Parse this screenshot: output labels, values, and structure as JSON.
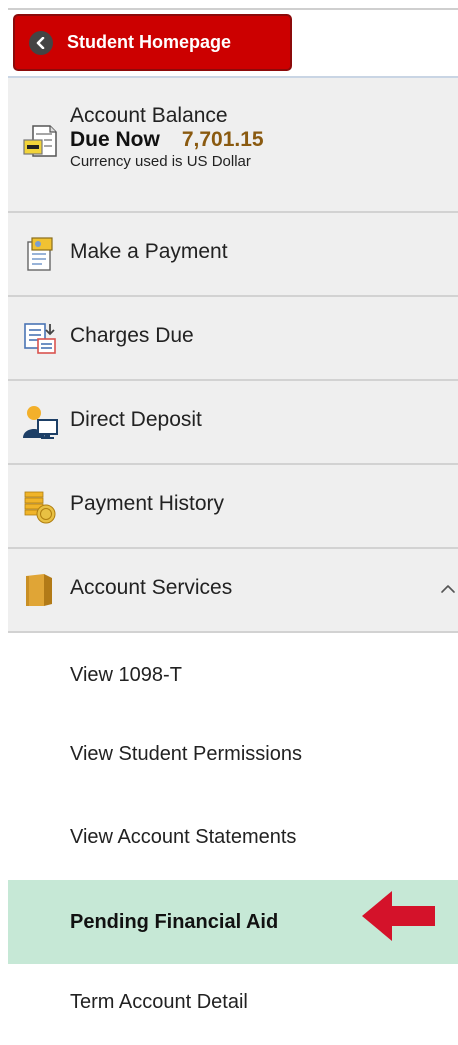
{
  "header": {
    "home_button_label": "Student Homepage"
  },
  "account_balance": {
    "title": "Account Balance",
    "due_label": "Due Now",
    "due_amount": "7,701.15",
    "currency_note": "Currency used is US Dollar"
  },
  "nav": {
    "items": [
      {
        "label": "Make a Payment",
        "icon": "make-payment-icon"
      },
      {
        "label": "Charges Due",
        "icon": "charges-due-icon"
      },
      {
        "label": "Direct Deposit",
        "icon": "direct-deposit-icon"
      },
      {
        "label": "Payment History",
        "icon": "payment-history-icon"
      },
      {
        "label": "Account Services",
        "icon": "account-services-folder-icon",
        "expanded": true
      }
    ]
  },
  "account_services": {
    "items": [
      {
        "label": "View 1098-T"
      },
      {
        "label": "View Student Permissions"
      },
      {
        "label": "View Account Statements"
      },
      {
        "label": "Pending Financial Aid",
        "selected": true
      },
      {
        "label": "Term Account Detail"
      }
    ]
  },
  "colors": {
    "home_button": "#cc0000",
    "selected_row": "#c6e8d6",
    "due_amount": "#8a5a10",
    "pointer_arrow": "#d4122a"
  }
}
